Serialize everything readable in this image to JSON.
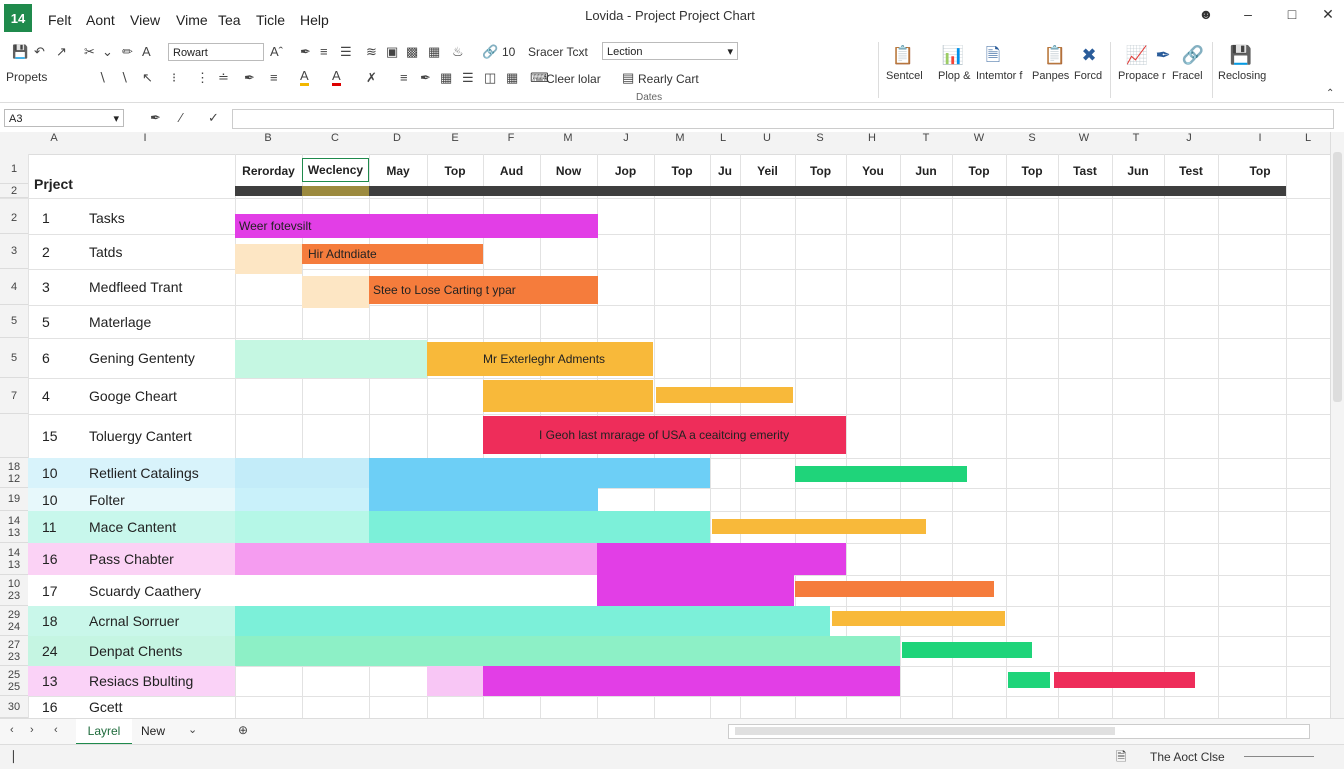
{
  "app": {
    "icon_text": "14",
    "title": "Lovida - Project Project Chart",
    "menu": [
      "Felt",
      "Aont",
      "View",
      "Vime",
      "Tea",
      "Ticle",
      "Help"
    ]
  },
  "ribbon": {
    "left_label": "Propets",
    "font_name": "Rowart",
    "size_num": "10",
    "style_box_label": "Sracer Tcxt",
    "style_select": "Lection",
    "clear_label": "Cleer lolar",
    "reality_label": "Rearly Cart",
    "group_label": "Dates",
    "groups": [
      "Sentcel",
      "Plop &",
      "Intemtor f",
      "Panpes",
      "Forcd",
      "Propace r",
      "Fracel",
      "Reclosing"
    ]
  },
  "formula": {
    "cell_ref": "A3"
  },
  "columns": [
    "A",
    "I",
    "B",
    "C",
    "D",
    "E",
    "F",
    "M",
    "J",
    "M",
    "L",
    "U",
    "S",
    "H",
    "T",
    "W",
    "S",
    "W",
    "T",
    "J",
    "I",
    "L"
  ],
  "header": {
    "project_label": "Prject",
    "months": [
      "Rerorday",
      "Weclency",
      "May",
      "Top",
      "Aud",
      "Now",
      "Jop",
      "Top",
      "Ju",
      "Yeil",
      "Top",
      "You",
      "Jun",
      "Top",
      "Top",
      "Tast",
      "Jun",
      "Test",
      "Top"
    ]
  },
  "rows": [
    {
      "hdr": "2",
      "num": "1",
      "name": "Tasks"
    },
    {
      "hdr": "3",
      "num": "2",
      "name": "Tatds"
    },
    {
      "hdr": "4",
      "num": "3",
      "name": "Medfleed Trant"
    },
    {
      "hdr": "5",
      "num": "5",
      "name": "Materlage"
    },
    {
      "hdr": "5",
      "num": "6",
      "name": "Gening Gententy"
    },
    {
      "hdr": "7",
      "num": "4",
      "name": "Googe Cheart"
    },
    {
      "hdr": "",
      "num": "15",
      "name": "Toluergy Cantert"
    },
    {
      "hdr": "18\n12",
      "num": "10",
      "name": "Retlient Catalings"
    },
    {
      "hdr": "19",
      "num": "10",
      "name": "Folter"
    },
    {
      "hdr": "14\n13",
      "num": "11",
      "name": "Mace Cantent"
    },
    {
      "hdr": "14\n13",
      "num": "16",
      "name": "Pass Chabter"
    },
    {
      "hdr": "10\n23",
      "num": "17",
      "name": "Scuardy Caathery"
    },
    {
      "hdr": "29\n24",
      "num": "18",
      "name": "Acrnal Sorruer"
    },
    {
      "hdr": "27\n23",
      "num": "24",
      "name": "Denpat Chents"
    },
    {
      "hdr": "25\n25",
      "num": "13",
      "name": "Resiacs Bbulting"
    },
    {
      "hdr": "30",
      "num": "16",
      "name": "Gcett"
    }
  ],
  "bar_labels": {
    "b1": "Weer fotevsilt",
    "b2": "Hir Adtndiate",
    "b3": "Stee to Lose Carting t ypar",
    "b4": "Mr Exterleghr Adments",
    "b5": "I Geoh last mrarage of USA a ceaitcing emerity"
  },
  "colors": {
    "magenta": "#e23ee6",
    "orange": "#f57c3c",
    "yellow": "#f8b93a",
    "red": "#ee2d5a",
    "blue": "#6dcff6",
    "green": "#1fd47a",
    "teal": "#7cf0d9",
    "pink": "#f59cf0"
  },
  "tabs": {
    "active": "Layrel",
    "second": "New"
  },
  "status": {
    "text": "The Aoct Clse"
  }
}
